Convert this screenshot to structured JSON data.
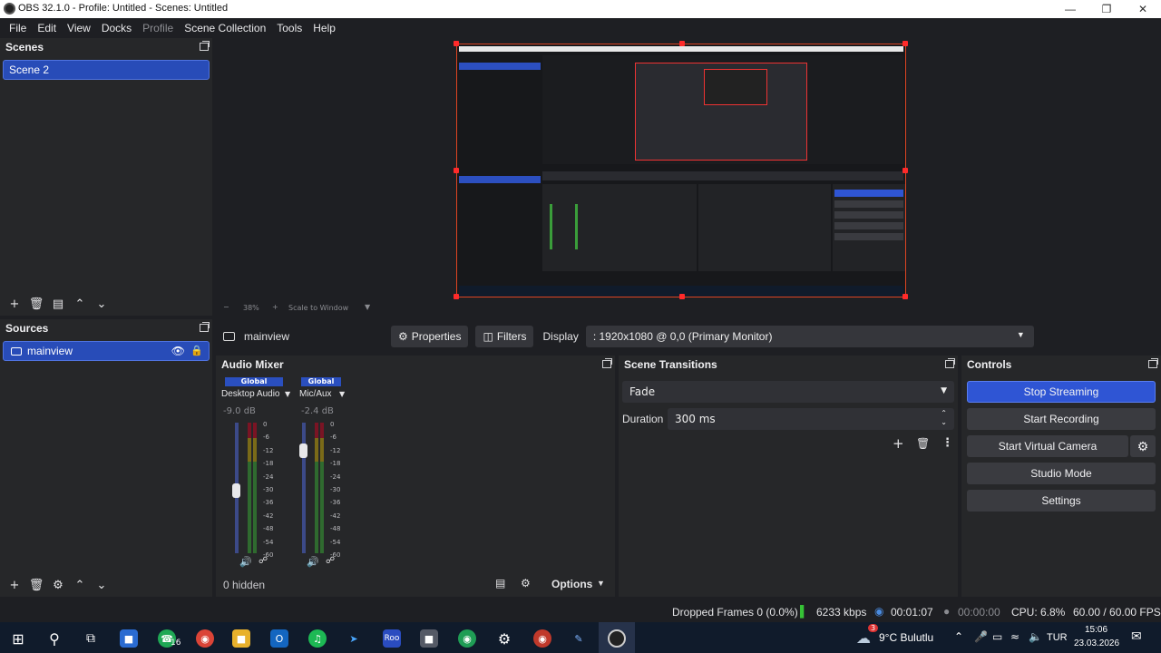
{
  "window": {
    "title": "OBS 32.1.0 - Profile: Untitled - Scenes: Untitled"
  },
  "menu": [
    "File",
    "Edit",
    "View",
    "Docks",
    "Profile",
    "Scene Collection",
    "Tools",
    "Help"
  ],
  "scenes": {
    "header": "Scenes",
    "items": [
      "Scene 2"
    ]
  },
  "sources": {
    "header": "Sources",
    "items": [
      "mainview"
    ]
  },
  "preview": {
    "zoom": "38%",
    "scale_mode": "Scale to Window"
  },
  "source_bar": {
    "selected": "mainview",
    "properties": "Properties",
    "filters": "Filters",
    "display_label": "Display",
    "display_value": ": 1920x1080 @ 0,0 (Primary Monitor)"
  },
  "audio_mixer": {
    "header": "Audio Mixer",
    "channels": [
      {
        "tag": "Global",
        "name": "Desktop Audio",
        "db": "-9.0 dB",
        "level": 0.48
      },
      {
        "tag": "Global",
        "name": "Mic/Aux",
        "db": "-2.4 dB",
        "level": 0.82
      }
    ],
    "scale": [
      "0",
      "-6",
      "-12",
      "-18",
      "-24",
      "-30",
      "-36",
      "-42",
      "-48",
      "-54",
      "-60"
    ],
    "hidden": "0 hidden",
    "options": "Options"
  },
  "transitions": {
    "header": "Scene Transitions",
    "type": "Fade",
    "duration_label": "Duration",
    "duration": "300 ms"
  },
  "controls": {
    "header": "Controls",
    "stop_streaming": "Stop Streaming",
    "start_recording": "Start Recording",
    "start_virtual_camera": "Start Virtual Camera",
    "studio_mode": "Studio Mode",
    "settings": "Settings"
  },
  "status": {
    "dropped": "Dropped Frames 0 (0.0%)",
    "bitrate": "6233 kbps",
    "stream_time": "00:01:07",
    "rec_time": "00:00:00",
    "cpu": "CPU: 6.8%",
    "fps": "60.00 / 60.00 FPS"
  },
  "taskbar": {
    "weather": "9°C Bulutlu",
    "weather_badge": "3",
    "lang": "TUR",
    "time": "15:06",
    "date": "23.03.2026",
    "whatsapp_badge": "16",
    "roo_label": "Roo"
  },
  "colors": {
    "accent": "#2f55d4",
    "bg": "#1e1f23",
    "panel": "#262729",
    "handle": "#ff2a2a"
  }
}
